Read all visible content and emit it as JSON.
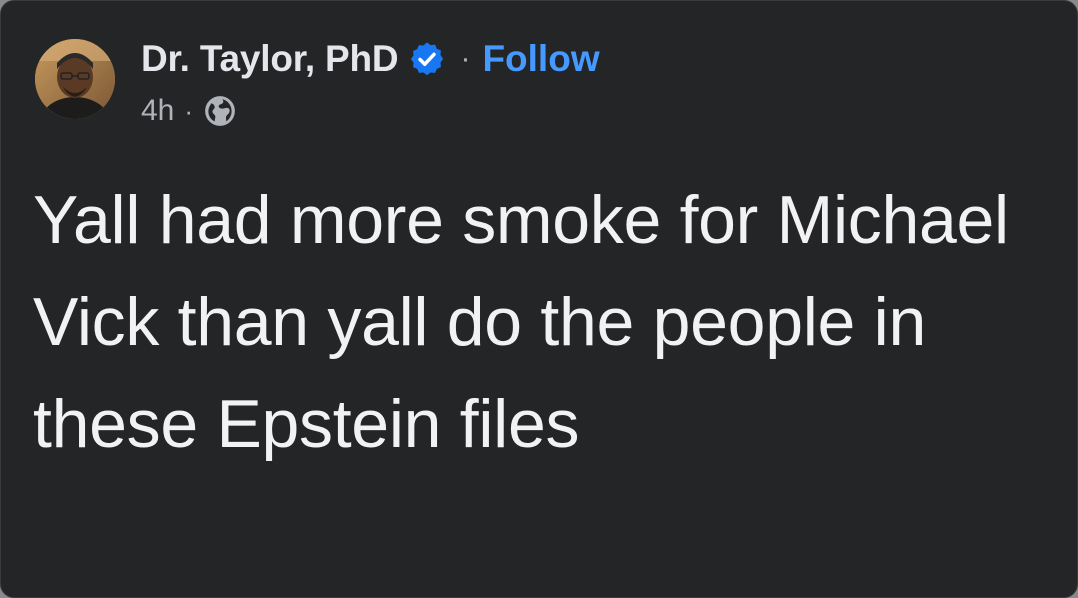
{
  "post": {
    "author_name": "Dr. Taylor, PhD",
    "separator": "·",
    "follow_label": "Follow",
    "time_ago": "4h",
    "meta_separator": "·",
    "audience_icon": "globe-icon",
    "verified_icon": "verified-badge-icon",
    "text": "Yall had more smoke for Michael Vick than yall do the people in these Epstein files"
  },
  "colors": {
    "card_background": "#242526",
    "primary_text": "#e4e6eb",
    "secondary_text": "#b0b3b8",
    "link_blue": "#4599ff",
    "verified_blue": "#1877f2"
  }
}
